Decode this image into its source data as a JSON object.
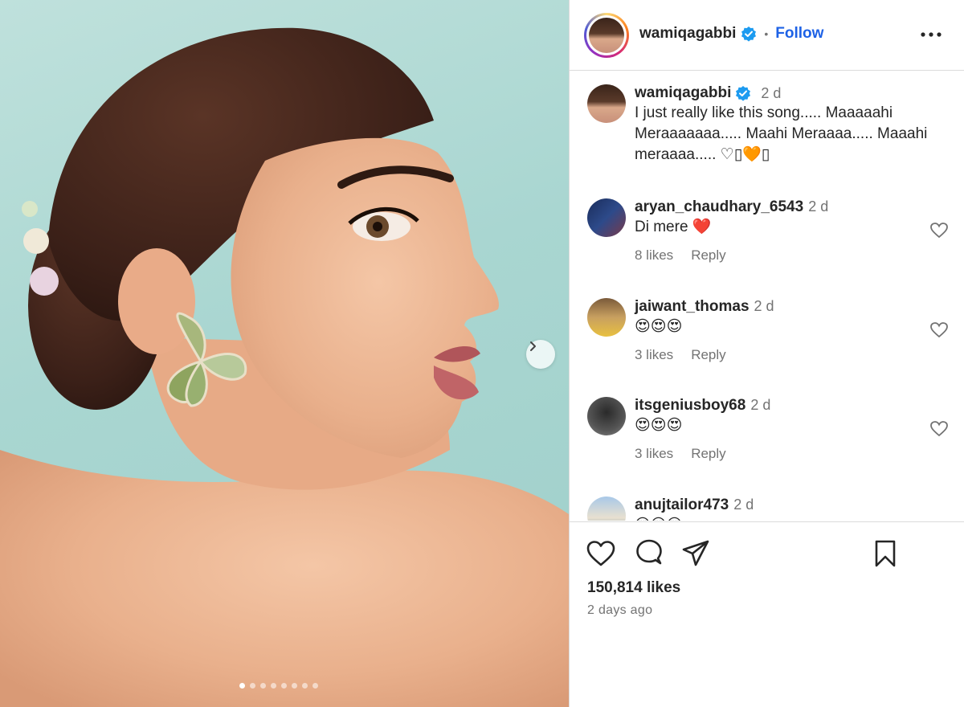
{
  "post": {
    "slide_count": 8,
    "active_slide": 1
  },
  "header": {
    "username": "wamiqagabbi",
    "separator": "•",
    "follow_label": "Follow",
    "more_icon": "more-horizontal-icon"
  },
  "caption": {
    "username": "wamiqagabbi",
    "time": "2 d",
    "text": "I just really like this song..... Maaaaahi Meraaaaaaa..... Maahi Meraaaa..... Maaahi meraaaa..... ♡▯🧡▯"
  },
  "comments": [
    {
      "username": "aryan_chaudhary_6543",
      "time": "2 d",
      "text": "Di mere ❤️",
      "likes": "8 likes",
      "reply": "Reply"
    },
    {
      "username": "jaiwant_thomas",
      "time": "2 d",
      "text": "😍😍😍",
      "likes": "3 likes",
      "reply": "Reply"
    },
    {
      "username": "itsgeniusboy68",
      "time": "2 d",
      "text": "😍😍😍",
      "likes": "3 likes",
      "reply": "Reply"
    },
    {
      "username": "anujtailor473",
      "time": "2 d",
      "text": "😍😍😍"
    }
  ],
  "footer": {
    "likes": "150,814 likes",
    "posted": "2 days ago"
  },
  "colors": {
    "follow": "#1e62e6",
    "verified": "#1d9bf0",
    "muted": "#737373",
    "border": "#dbdbdb"
  }
}
